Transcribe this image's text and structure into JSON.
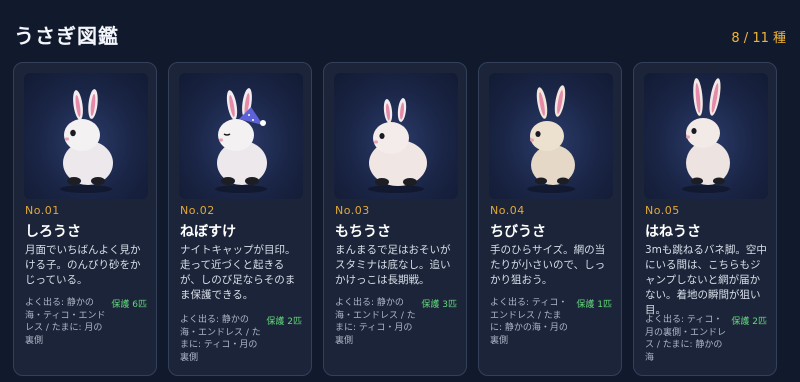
{
  "header": {
    "title": "うさぎ図鑑",
    "count": "8 / 11 種"
  },
  "colors": {
    "background": "#111a2c",
    "card": "#1b2438",
    "accent_number": "#e3a83a",
    "protect": "#63d87b"
  },
  "cards": [
    {
      "number": "No.01",
      "name": "しろうさ",
      "description": "月面でいちばんよく見かける子。のんびり砂をかじっている。",
      "habitat": "よく出る: 静かの海・ティコ・エンドレス / たまに: 月の裏側",
      "protected": "保護 6匹",
      "icon": "white-rabbit-icon"
    },
    {
      "number": "No.02",
      "name": "ねぼすけ",
      "description": "ナイトキャップが目印。走って近づくと起きるが、しのび足ならそのまま保護できる。",
      "habitat": "よく出る: 静かの海・エンドレス / たまに: ティコ・月の裏側",
      "protected": "保護 2匹",
      "icon": "sleepy-rabbit-icon"
    },
    {
      "number": "No.03",
      "name": "もちうさ",
      "description": "まんまるで足はおそいがスタミナは底なし。追いかけっこは長期戦。",
      "habitat": "よく出る: 静かの海・エンドレス / たまに: ティコ・月の裏側",
      "protected": "保護 3匹",
      "icon": "round-rabbit-icon"
    },
    {
      "number": "No.04",
      "name": "ちびうさ",
      "description": "手のひらサイズ。網の当たりが小さいので、しっかり狙おう。",
      "habitat": "よく出る: ティコ・エンドレス / たまに: 静かの海・月の裏側",
      "protected": "保護 1匹",
      "icon": "small-rabbit-icon"
    },
    {
      "number": "No.05",
      "name": "はねうさ",
      "description": "3mも跳ねるバネ脚。空中にいる間は、こちらもジャンプしないと網が届かない。着地の瞬間が狙い目。",
      "habitat": "よく出る: ティコ・月の裏側・エンドレス / たまに: 静かの海",
      "protected": "保護 2匹",
      "icon": "jumping-rabbit-icon"
    }
  ]
}
